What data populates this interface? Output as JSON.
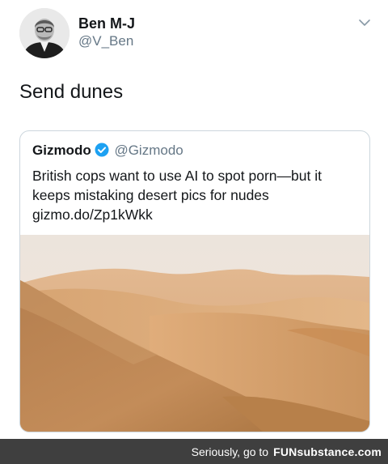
{
  "tweet": {
    "author_name": "Ben M-J",
    "author_handle": "@V_Ben",
    "text": "Send dunes"
  },
  "quoted_tweet": {
    "author_name": "Gizmodo",
    "author_handle": "@Gizmodo",
    "verified": true,
    "text": "British cops want to use AI to spot porn—but it keeps mistaking desert pics for nudes gizmo.do/Zp1kWkk",
    "image": "desert-dunes-photo"
  },
  "footer": {
    "prefix": "Seriously, go to",
    "brand": "FUNsubstance.com"
  },
  "colors": {
    "verified_blue": "#1da1f2",
    "secondary_text": "#657786",
    "footer_bg": "#3f3f3f"
  }
}
